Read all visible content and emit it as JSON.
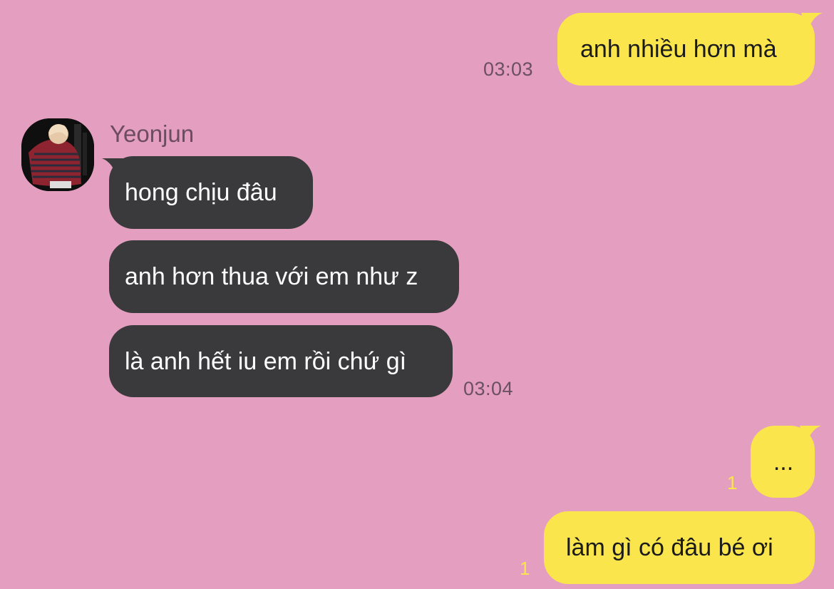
{
  "contact": {
    "name": "Yeonjun",
    "avatar_icon": "profile-photo-avatar"
  },
  "colors": {
    "background": "#e49ebf",
    "my_bubble": "#fbe54c",
    "their_bubble": "#3a3a3c",
    "timestamp": "#6a5062",
    "unread": "#fbe54c"
  },
  "messages": [
    {
      "sender": "me",
      "text": "anh nhiều hơn mà",
      "time": "03:03"
    },
    {
      "sender": "Yeonjun",
      "text": "hong chịu đâu"
    },
    {
      "sender": "Yeonjun",
      "text": "anh hơn thua với em như z"
    },
    {
      "sender": "Yeonjun",
      "text": "là anh hết iu em rồi chứ gì",
      "time": "03:04"
    },
    {
      "sender": "me",
      "text": "...",
      "unread": "1"
    },
    {
      "sender": "me",
      "text": "làm gì có đâu bé ơi",
      "unread": "1"
    }
  ]
}
